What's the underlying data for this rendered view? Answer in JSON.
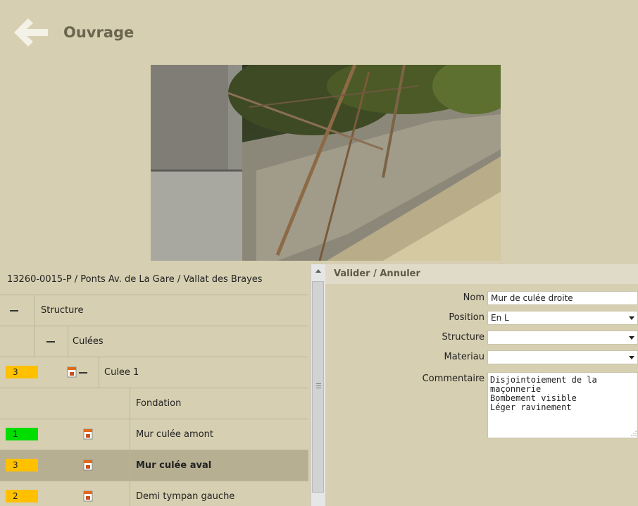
{
  "header": {
    "title": "Ouvrage",
    "back_icon": "arrow-left-icon"
  },
  "photo": {
    "description_icon": "photo-image"
  },
  "tree": {
    "breadcrumb": "13260-0015-P / Ponts Av. de La Gare / Vallat des Brayes",
    "structure_label": "Structure",
    "culees_label": "Culées",
    "culee1": {
      "badge": "3",
      "badge_color": "#ffc000",
      "label": "Culee 1"
    },
    "fondation_label": "Fondation",
    "items": [
      {
        "badge": "1",
        "badge_color": "#00dd00",
        "label": "Mur culée amont"
      },
      {
        "badge": "3",
        "badge_color": "#ffc000",
        "label": "Mur culée aval"
      },
      {
        "badge": "2",
        "badge_color": "#ffc000",
        "label": "Demi tympan gauche"
      }
    ]
  },
  "form": {
    "action_label": "Valider / Annuler",
    "nom_label": "Nom",
    "nom_value": "Mur de culée droite",
    "position_label": "Position",
    "position_value": "En L",
    "structure_label": "Structure",
    "structure_value": "",
    "materiau_label": "Materiau",
    "materiau_value": "",
    "commentaire_label": "Commentaire",
    "commentaire_value": "Disjointoiement de la\nmaçonnerie\nBombement visible\nLéger ravinement"
  }
}
